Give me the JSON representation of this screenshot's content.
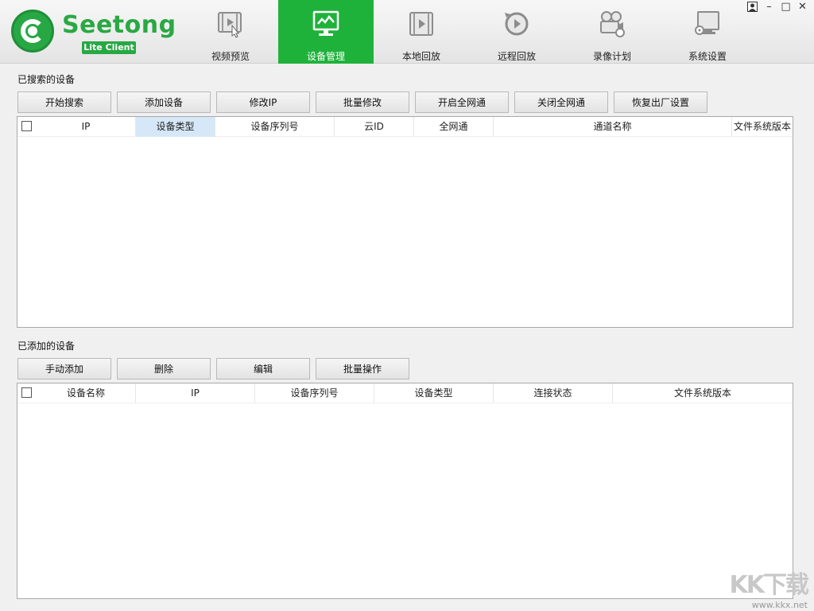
{
  "app": {
    "logo_text": "Seetong",
    "logo_badge": "Lite Client"
  },
  "nav": {
    "tabs": [
      {
        "label": "视频预览",
        "icon": "video-preview-icon",
        "active": false
      },
      {
        "label": "设备管理",
        "icon": "device-management-icon",
        "active": true
      },
      {
        "label": "本地回放",
        "icon": "local-playback-icon",
        "active": false
      },
      {
        "label": "远程回放",
        "icon": "remote-playback-icon",
        "active": false
      },
      {
        "label": "录像计划",
        "icon": "recording-schedule-icon",
        "active": false
      },
      {
        "label": "系统设置",
        "icon": "system-settings-icon",
        "active": false
      }
    ]
  },
  "window_controls": {
    "user": "user-icon",
    "minimize": "–",
    "maximize": "□",
    "close": "✕"
  },
  "searched": {
    "title": "已搜索的设备",
    "buttons": [
      "开始搜索",
      "添加设备",
      "修改IP",
      "批量修改",
      "开启全网通",
      "关闭全网通",
      "恢复出厂设置"
    ],
    "columns": [
      "IP",
      "设备类型",
      "设备序列号",
      "云ID",
      "全网通",
      "通道名称",
      "文件系统版本"
    ],
    "rows": []
  },
  "added": {
    "title": "已添加的设备",
    "buttons": [
      "手动添加",
      "删除",
      "编辑",
      "批量操作"
    ],
    "columns": [
      "设备名称",
      "IP",
      "设备序列号",
      "设备类型",
      "连接状态",
      "文件系统版本"
    ],
    "rows": []
  },
  "watermark": {
    "logo": "KK下载",
    "url": "www.kkx.net"
  },
  "colors": {
    "accent": "#1fb23b",
    "brand": "#2aa844",
    "selected_header": "#d6e8f7"
  }
}
